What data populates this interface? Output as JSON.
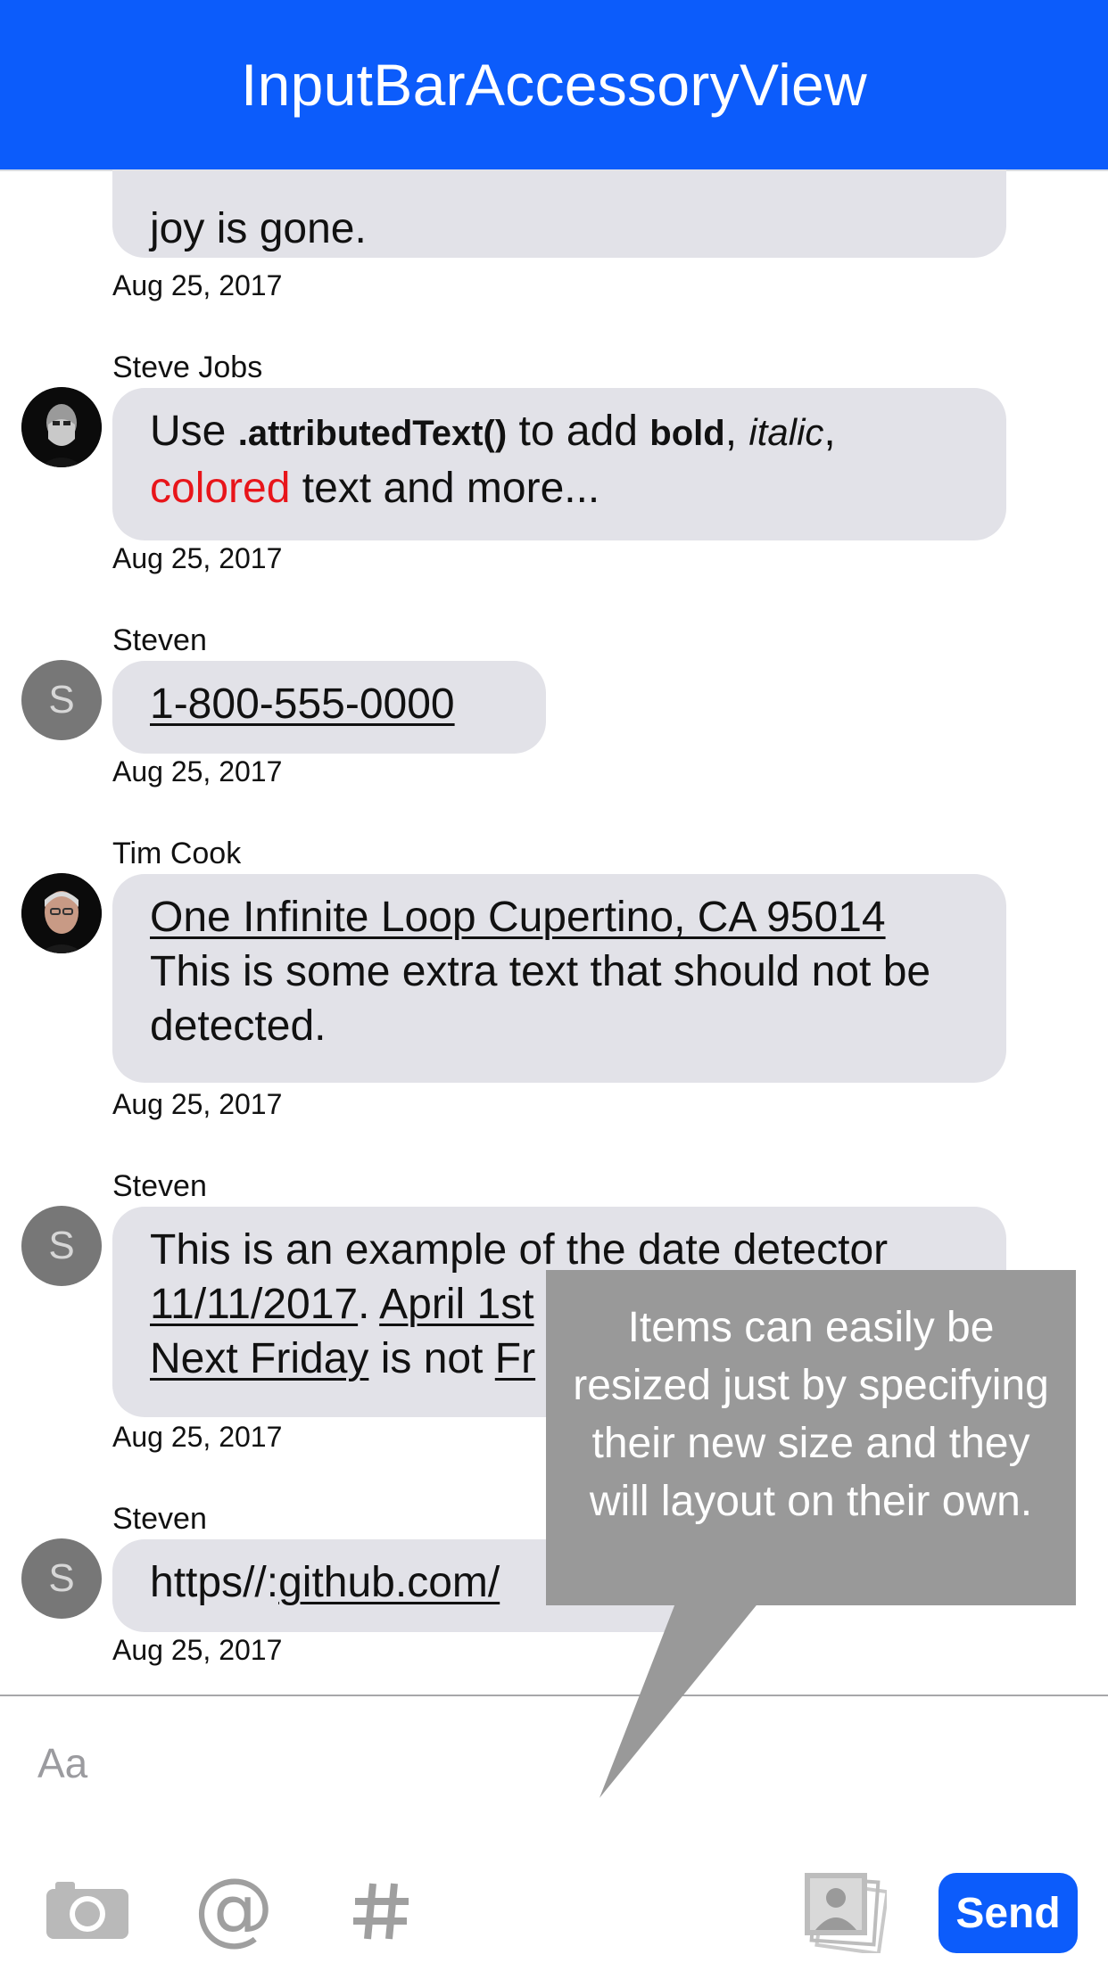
{
  "navbar": {
    "title": "InputBarAccessoryView"
  },
  "messages": [
    {
      "text": "joy is gone.",
      "date": "Aug 25, 2017"
    },
    {
      "sender": "Steve Jobs",
      "date": "Aug 25, 2017",
      "parts": [
        "Use ",
        ".attributedText()",
        " to add ",
        "bold",
        ", ",
        "italic",
        ",",
        "colored",
        " text and more..."
      ]
    },
    {
      "sender": "Steven",
      "avatar_initial": "S",
      "date": "Aug 25, 2017",
      "phone": "1-800-555-0000"
    },
    {
      "sender": "Tim Cook",
      "date": "Aug 25, 2017",
      "address": "One Infinite Loop Cupertino, CA 95014",
      "rest": "This is some extra text that should not be detected."
    },
    {
      "sender": "Steven",
      "avatar_initial": "S",
      "date": "Aug 25, 2017",
      "parts": [
        "This is an example of the date detector",
        "11/11/2017",
        ". ",
        "April 1st",
        "Next Friday",
        " is not ",
        "Fr"
      ]
    },
    {
      "sender": "Steven",
      "avatar_initial": "S",
      "date": "Aug 25, 2017",
      "url_prefix": "https//:",
      "url_link": "github.com/"
    }
  ],
  "input": {
    "placeholder": "Aa",
    "send_label": "Send",
    "icons": [
      "camera-icon",
      "at-icon",
      "hashtag-icon",
      "photos-icon"
    ]
  },
  "tooltip": {
    "text": "Items can easily be resized just by specifying their new size and they will layout on their own."
  },
  "colors": {
    "accent": "#0c5cfb",
    "bubble": "#e2e2e8",
    "attributed_red": "#e8151a",
    "tooltip": "#999999"
  }
}
